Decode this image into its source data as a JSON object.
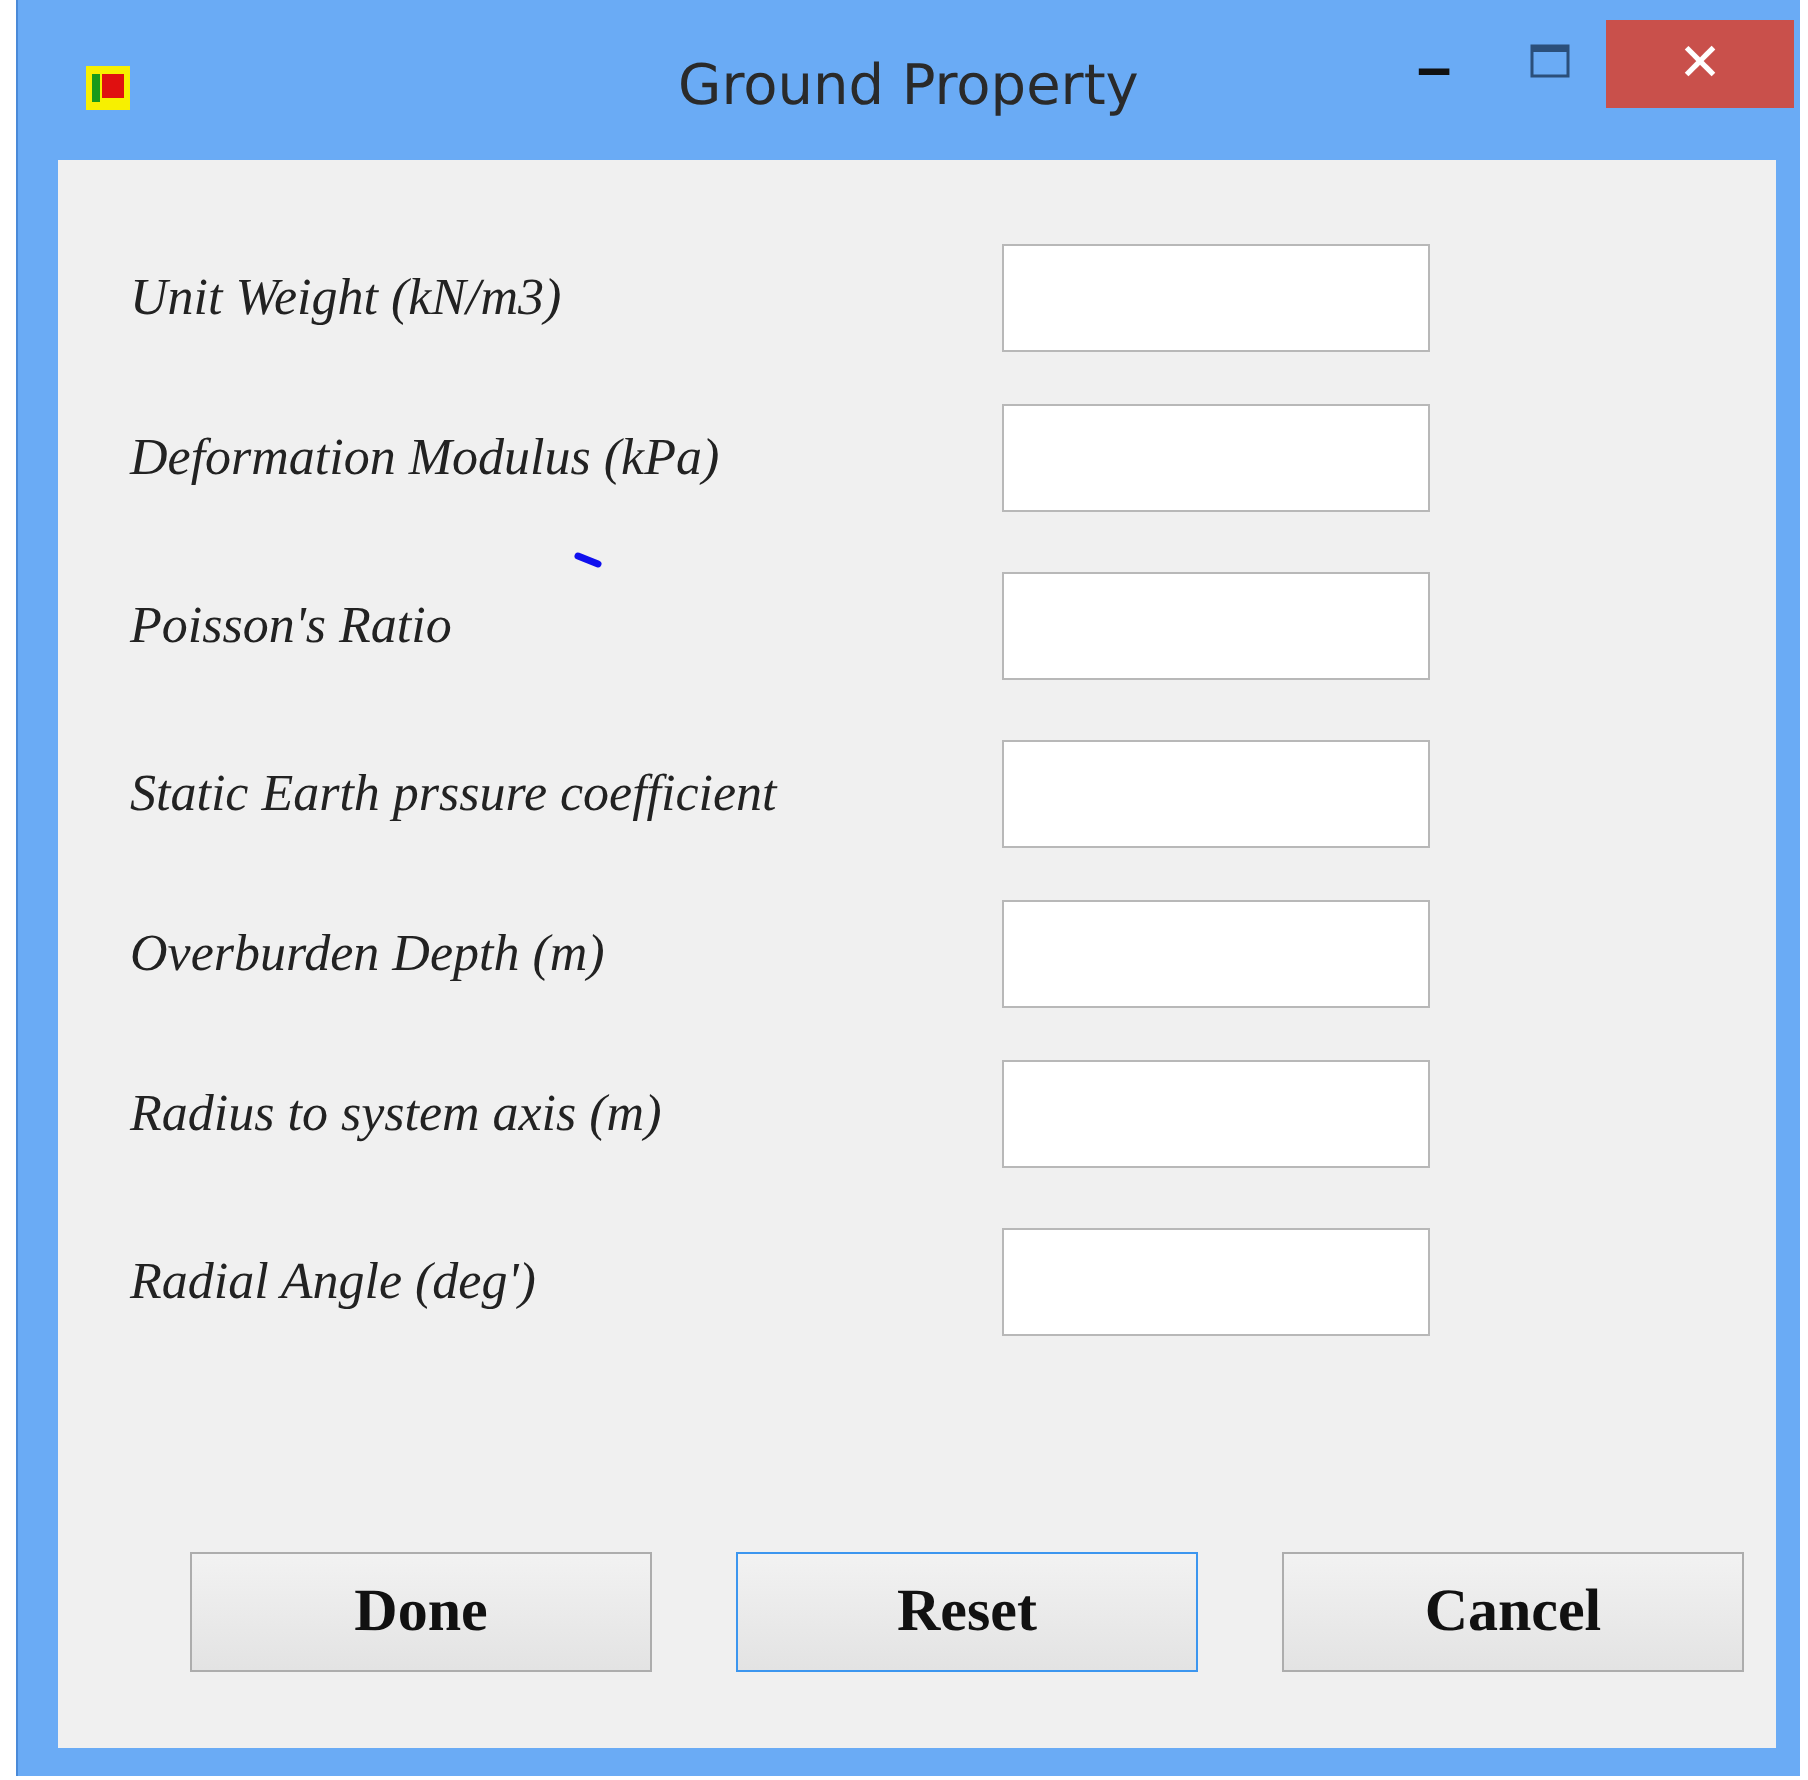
{
  "window": {
    "title": "Ground Property",
    "controls": [
      "‒",
      "✕"
    ]
  },
  "fields": [
    {
      "label": "Unit Weight (kN/m3)"
    },
    {
      "label": "Deformation Modulus (kPa)"
    },
    {
      "label": "Poisson's Ratio"
    },
    {
      "label": "Static Earth prssure coefficient"
    },
    {
      "label": "Overburden Depth (m)"
    },
    {
      "label": "Radius to system axis (m)"
    },
    {
      "label": "Radial Angle (deg')"
    }
  ],
  "buttons": [
    {
      "label": "Done",
      "focused": false
    },
    {
      "label": "Reset",
      "focused": true
    },
    {
      "label": "Cancel",
      "focused": false
    }
  ]
}
